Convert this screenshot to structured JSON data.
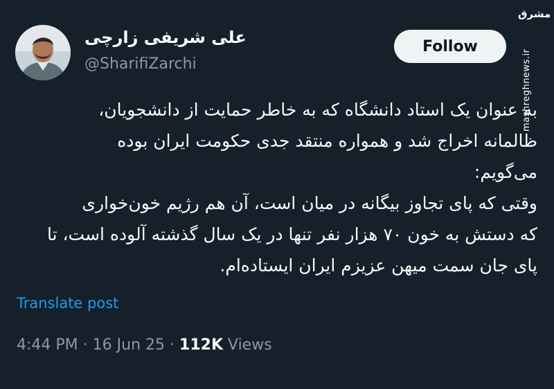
{
  "watermark": {
    "logo_text": "مشرق",
    "url": "mashreghnews.ir"
  },
  "author": {
    "display_name": "علی شریفی زارچی",
    "handle": "@SharifiZarchi",
    "avatar": "profile-photo"
  },
  "follow_label": "Follow",
  "tweet": {
    "lines": [
      "به عنوان یک استاد دانشگاه که به خاطر حمایت از دانشجویان،",
      "ظالمانه اخراج شد و همواره منتقد جدی حکومت ایران بوده",
      "می‌گویم:",
      "وقتی که پای تجاوز بیگانه در میان است، آن هم رژیم خون‌خواری",
      "که دستش به خون ۷۰ هزار نفر تنها در یک سال گذشته آلوده است، تا",
      "پای جان سمت میهن عزیزم ایران ایستاده‌ام."
    ]
  },
  "translate_label": "Translate post",
  "meta": {
    "time": "4:44 PM",
    "sep1": "·",
    "date": "16 Jun 25",
    "sep2": "·",
    "views_count": "112K",
    "views_label": "Views"
  },
  "colors": {
    "background": "#15202b",
    "link": "#1d9bf0",
    "muted": "#8b98a5"
  }
}
